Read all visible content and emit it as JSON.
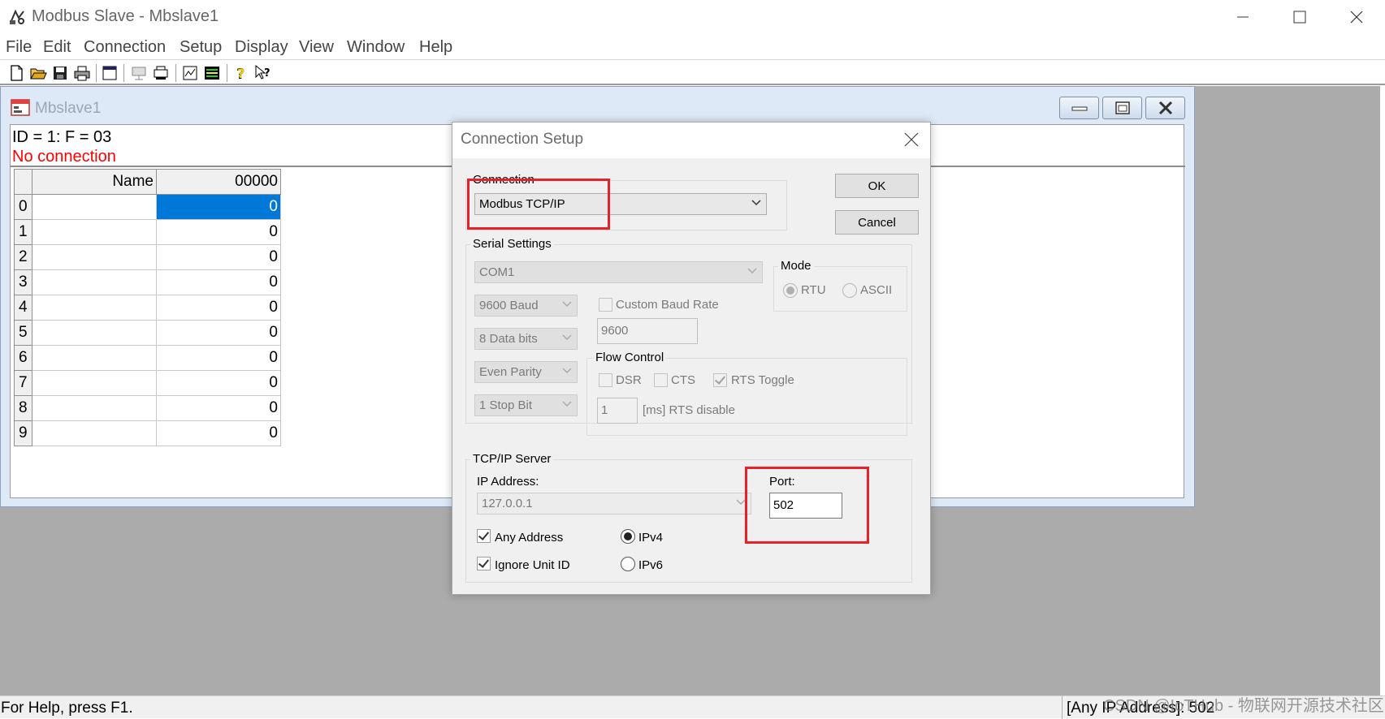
{
  "app": {
    "title": "Modbus Slave - Mbslave1"
  },
  "menu": [
    "File",
    "Edit",
    "Connection",
    "Setup",
    "Display",
    "View",
    "Window",
    "Help"
  ],
  "toolbar_icons": [
    "new-icon",
    "open-icon",
    "save-icon",
    "print-icon",
    "window-icon",
    "connect-icon",
    "disconnect-icon",
    "log-icon",
    "monitor-icon",
    "help-icon",
    "context-help-icon"
  ],
  "child": {
    "title": "Mbslave1",
    "id_line": "ID = 1: F = 03",
    "status_line": "No connection",
    "grid": {
      "headers": [
        "Name",
        "00000"
      ],
      "rows": [
        {
          "index": "0",
          "name": "",
          "value": "0"
        },
        {
          "index": "1",
          "name": "",
          "value": "0"
        },
        {
          "index": "2",
          "name": "",
          "value": "0"
        },
        {
          "index": "3",
          "name": "",
          "value": "0"
        },
        {
          "index": "4",
          "name": "",
          "value": "0"
        },
        {
          "index": "5",
          "name": "",
          "value": "0"
        },
        {
          "index": "6",
          "name": "",
          "value": "0"
        },
        {
          "index": "7",
          "name": "",
          "value": "0"
        },
        {
          "index": "8",
          "name": "",
          "value": "0"
        },
        {
          "index": "9",
          "name": "",
          "value": "0"
        }
      ]
    }
  },
  "dialog": {
    "title": "Connection Setup",
    "ok_label": "OK",
    "cancel_label": "Cancel",
    "connection": {
      "label": "Connection",
      "value": "Modbus TCP/IP"
    },
    "serial": {
      "label": "Serial Settings",
      "port": "COM1",
      "baud": "9600 Baud",
      "data_bits": "8 Data bits",
      "parity": "Even Parity",
      "stop_bits": "1 Stop Bit",
      "custom_baud_label": "Custom Baud Rate",
      "custom_baud_value": "9600",
      "mode": {
        "label": "Mode",
        "rtu": "RTU",
        "ascii": "ASCII"
      },
      "flow": {
        "label": "Flow Control",
        "dsr": "DSR",
        "cts": "CTS",
        "rts_toggle": "RTS Toggle",
        "rts_delay_value": "1",
        "rts_delay_label": "[ms] RTS disable"
      }
    },
    "tcp": {
      "label": "TCP/IP Server",
      "ip_label": "IP Address:",
      "ip_value": "127.0.0.1",
      "port_label": "Port:",
      "port_value": "502",
      "any_address": "Any Address",
      "ignore_unit_id": "Ignore Unit ID",
      "ipv4": "IPv4",
      "ipv6": "IPv6"
    }
  },
  "statusbar": {
    "left": "For Help, press F1.",
    "right": "[Any IP Address]: 502"
  },
  "watermark": "CSDN @IoTHub - 物联网开源技术社区",
  "colors": {
    "highlight": "#e8202a",
    "selection": "#0078d7",
    "no_connection": "#ff0000"
  }
}
